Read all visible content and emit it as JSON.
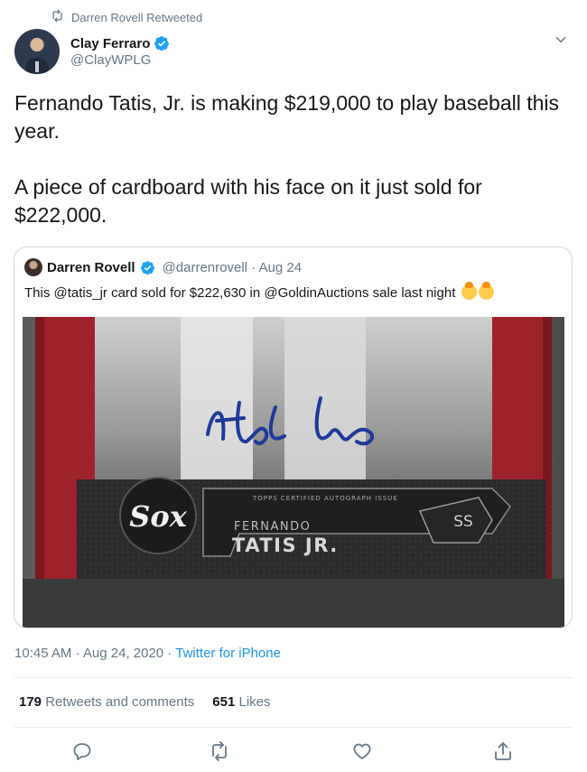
{
  "retweet": {
    "label": "Darren Rovell Retweeted",
    "icon": "retweet-icon"
  },
  "author": {
    "name": "Clay Ferraro",
    "handle": "@ClayWPLG",
    "verified": true
  },
  "tweet": {
    "paragraphs": [
      "Fernando Tatis, Jr. is making $219,000 to play baseball this year.",
      "A piece of cardboard with his face on it just sold for $222,000."
    ]
  },
  "quoted": {
    "name": "Darren Rovell",
    "handle": "@darrenrovell",
    "separator": "·",
    "date": "Aug 24",
    "text": "This @tatis_jr card sold for $222,630 in @GoldinAuctions sale last night",
    "card": {
      "team_logo": "Sox",
      "issue_text": "TOPPS CERTIFIED AUTOGRAPH ISSUE",
      "first_name": "FERNANDO",
      "last_name": "TATIS JR.",
      "position": "SS"
    }
  },
  "meta": {
    "time": "10:45 AM",
    "separator": "·",
    "date": "Aug 24, 2020",
    "source": "Twitter for iPhone"
  },
  "stats": {
    "retweets_count": "179",
    "retweets_label": "Retweets and comments",
    "likes_count": "651",
    "likes_label": "Likes"
  },
  "actions": [
    "reply-icon",
    "retweet-icon",
    "like-icon",
    "share-icon"
  ],
  "colors": {
    "link": "#1b95e0",
    "verified": "#1da1f2",
    "muted": "#657786",
    "border": "#ccd6dd"
  }
}
